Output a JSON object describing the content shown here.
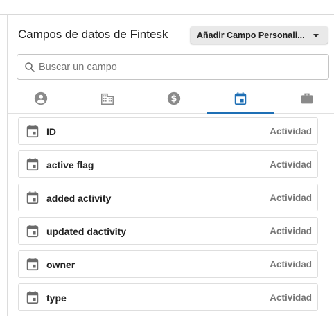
{
  "header": {
    "title": "Campos de datos de Fintesk",
    "add_button_label": "Añadir Campo Personali..."
  },
  "search": {
    "placeholder": "Buscar un campo",
    "value": ""
  },
  "tabs": [
    {
      "icon": "person-icon",
      "active": false
    },
    {
      "icon": "building-icon",
      "active": false
    },
    {
      "icon": "dollar-icon",
      "active": false
    },
    {
      "icon": "calendar-icon",
      "active": true
    },
    {
      "icon": "briefcase-icon",
      "active": false
    }
  ],
  "fields": [
    {
      "name": "ID",
      "category": "Actividad",
      "icon": "calendar-icon"
    },
    {
      "name": "active flag",
      "category": "Actividad",
      "icon": "calendar-icon"
    },
    {
      "name": "added activity",
      "category": "Actividad",
      "icon": "calendar-icon"
    },
    {
      "name": "updated dactivity",
      "category": "Actividad",
      "icon": "calendar-icon"
    },
    {
      "name": "owner",
      "category": "Actividad",
      "icon": "calendar-icon"
    },
    {
      "name": "type",
      "category": "Actividad",
      "icon": "calendar-icon"
    }
  ],
  "colors": {
    "accent": "#1e6fb5",
    "icon_inactive": "#8a8a8a",
    "row_icon": "#6b6b6b"
  }
}
